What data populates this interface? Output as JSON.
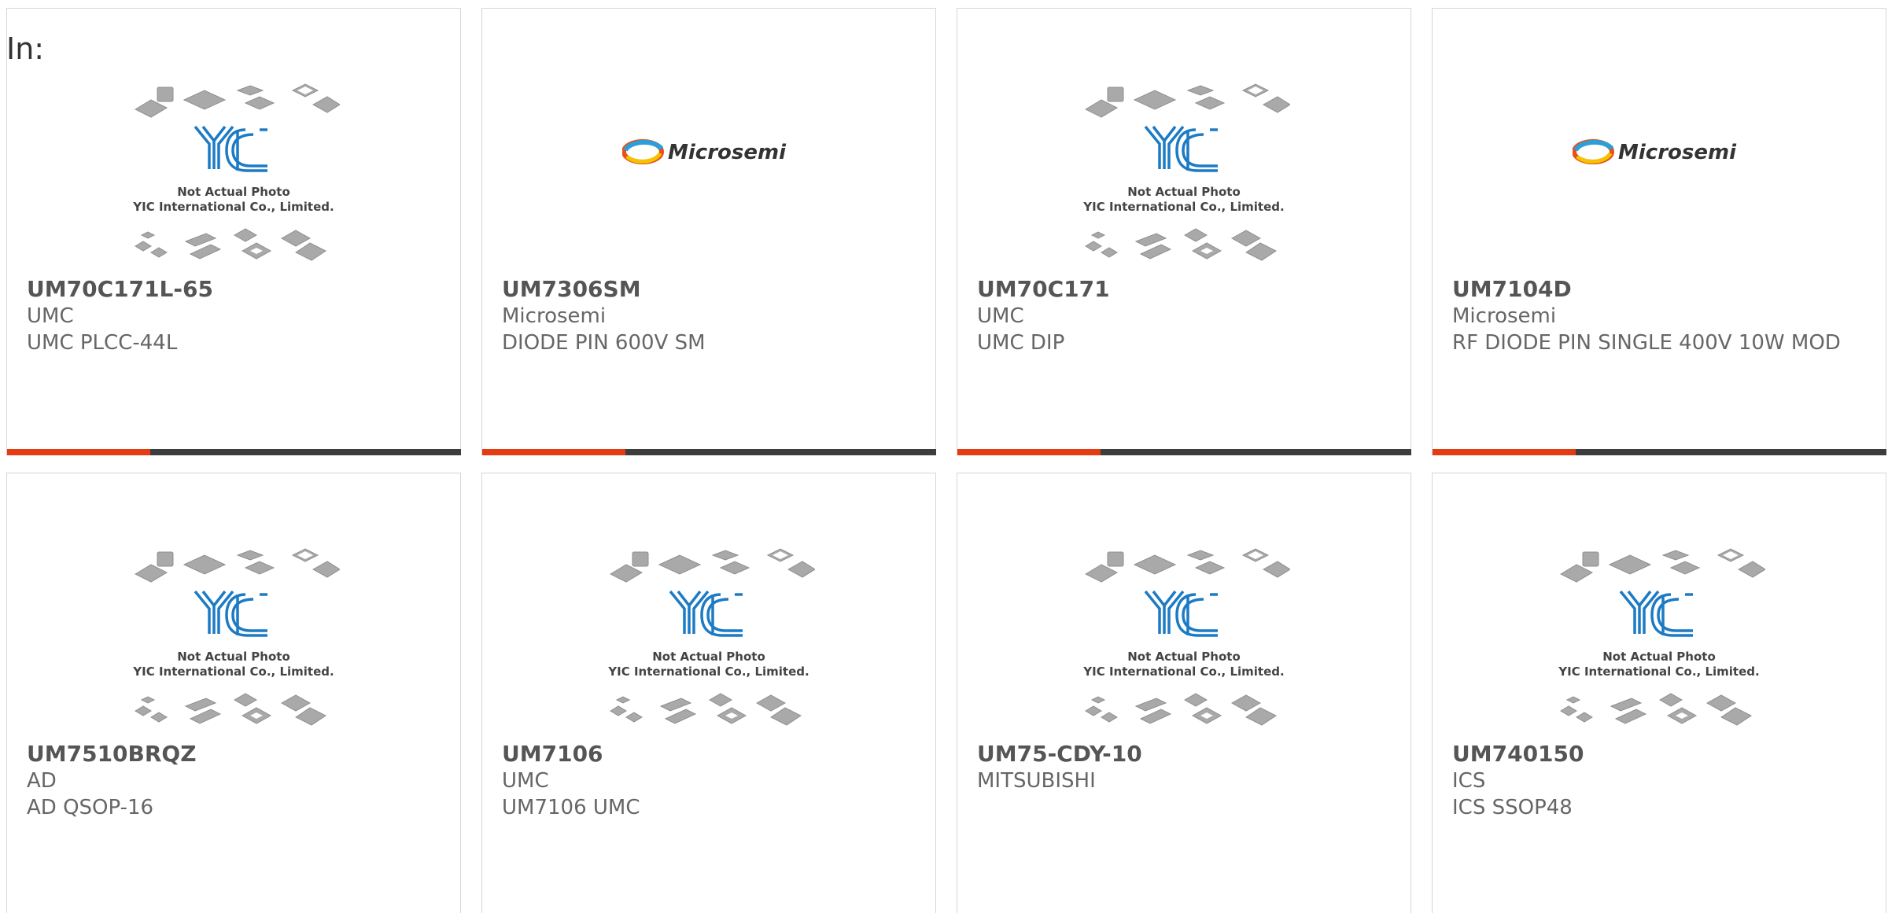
{
  "filter_label": "In:",
  "placeholder_caption": {
    "line1": "Not Actual Photo",
    "line2": "YIC International Co., Limited."
  },
  "brand_logo_text": "Microsemi",
  "accent_color": "#e43b12",
  "bar_color": "#3d3d3d",
  "logo_blue": "#1c7bc4",
  "products": [
    {
      "part": "UM70C171L-65",
      "maker": "UMC",
      "desc": "UMC PLCC-44L",
      "image": "yic-placeholder"
    },
    {
      "part": "UM7306SM",
      "maker": "Microsemi",
      "desc": "DIODE PIN 600V SM",
      "image": "microsemi-logo"
    },
    {
      "part": "UM70C171",
      "maker": "UMC",
      "desc": "UMC DIP",
      "image": "yic-placeholder"
    },
    {
      "part": "UM7104D",
      "maker": "Microsemi",
      "desc": "RF DIODE PIN SINGLE 400V 10W MOD",
      "image": "microsemi-logo"
    },
    {
      "part": "UM7510BRQZ",
      "maker": "AD",
      "desc": "AD QSOP-16",
      "image": "yic-placeholder"
    },
    {
      "part": "UM7106",
      "maker": "UMC",
      "desc": "UM7106 UMC",
      "image": "yic-placeholder"
    },
    {
      "part": "UM75-CDY-10",
      "maker": "MITSUBISHI",
      "desc": "",
      "image": "yic-placeholder"
    },
    {
      "part": "UM740150",
      "maker": "ICS",
      "desc": "ICS SSOP48",
      "image": "yic-placeholder"
    }
  ]
}
